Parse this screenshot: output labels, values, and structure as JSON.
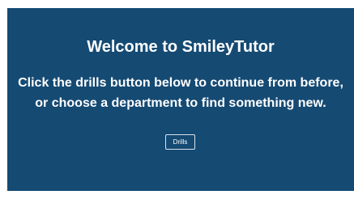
{
  "hero": {
    "title": "Welcome to SmileyTutor",
    "message": "Click the drills button below to continue from before, or choose a department to find something new.",
    "drills_button_label": "Drills"
  },
  "colors": {
    "panel_background": "#154a73",
    "page_background": "#ffffff",
    "text": "#ffffff"
  }
}
